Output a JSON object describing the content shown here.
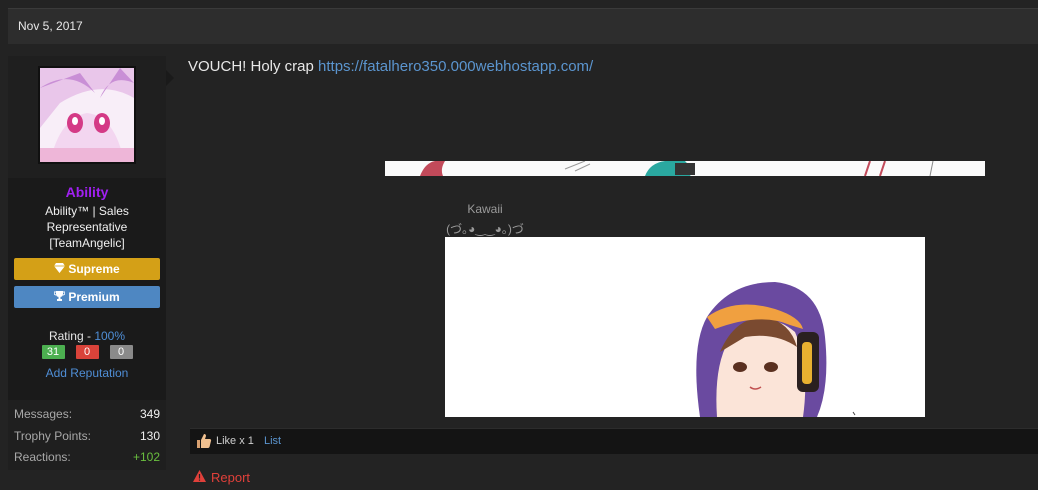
{
  "post": {
    "date": "Nov 5, 2017",
    "message_text": "VOUCH! Holy crap ",
    "message_link": "https://fatalhero350.000webhostapp.com/",
    "caption": "Kawaii",
    "kaomoji": "(づ｡◕‿‿◕｡)づ"
  },
  "user": {
    "username": "Ability",
    "username_color": "#a020f0",
    "title": "Ability™ | Sales Representative [TeamAngelic]",
    "banners": {
      "supreme": "Supreme",
      "premium": "Premium"
    },
    "rating_label": "Rating - ",
    "rating_pct": "100%",
    "rep": {
      "positive": "31",
      "neutral": "0",
      "negative": "0"
    },
    "add_rep": "Add Reputation",
    "stats": [
      {
        "label": "Messages:",
        "value": "349"
      },
      {
        "label": "Trophy Points:",
        "value": "130"
      },
      {
        "label": "Reactions:",
        "value": "+102"
      }
    ]
  },
  "likes": {
    "text": "Like x 1",
    "list": "List"
  },
  "actions": {
    "report": "Report"
  },
  "colors": {
    "supreme": "#d4a017",
    "premium": "#4e87c2",
    "rep_positive": "#4caf50",
    "rep_neutral": "#d9433a",
    "rep_negative": "#8a8a8a",
    "link": "#5b95cf"
  },
  "icons": [
    "diamond-icon",
    "trophy-icon",
    "thumbs-up-icon",
    "warning-icon"
  ]
}
